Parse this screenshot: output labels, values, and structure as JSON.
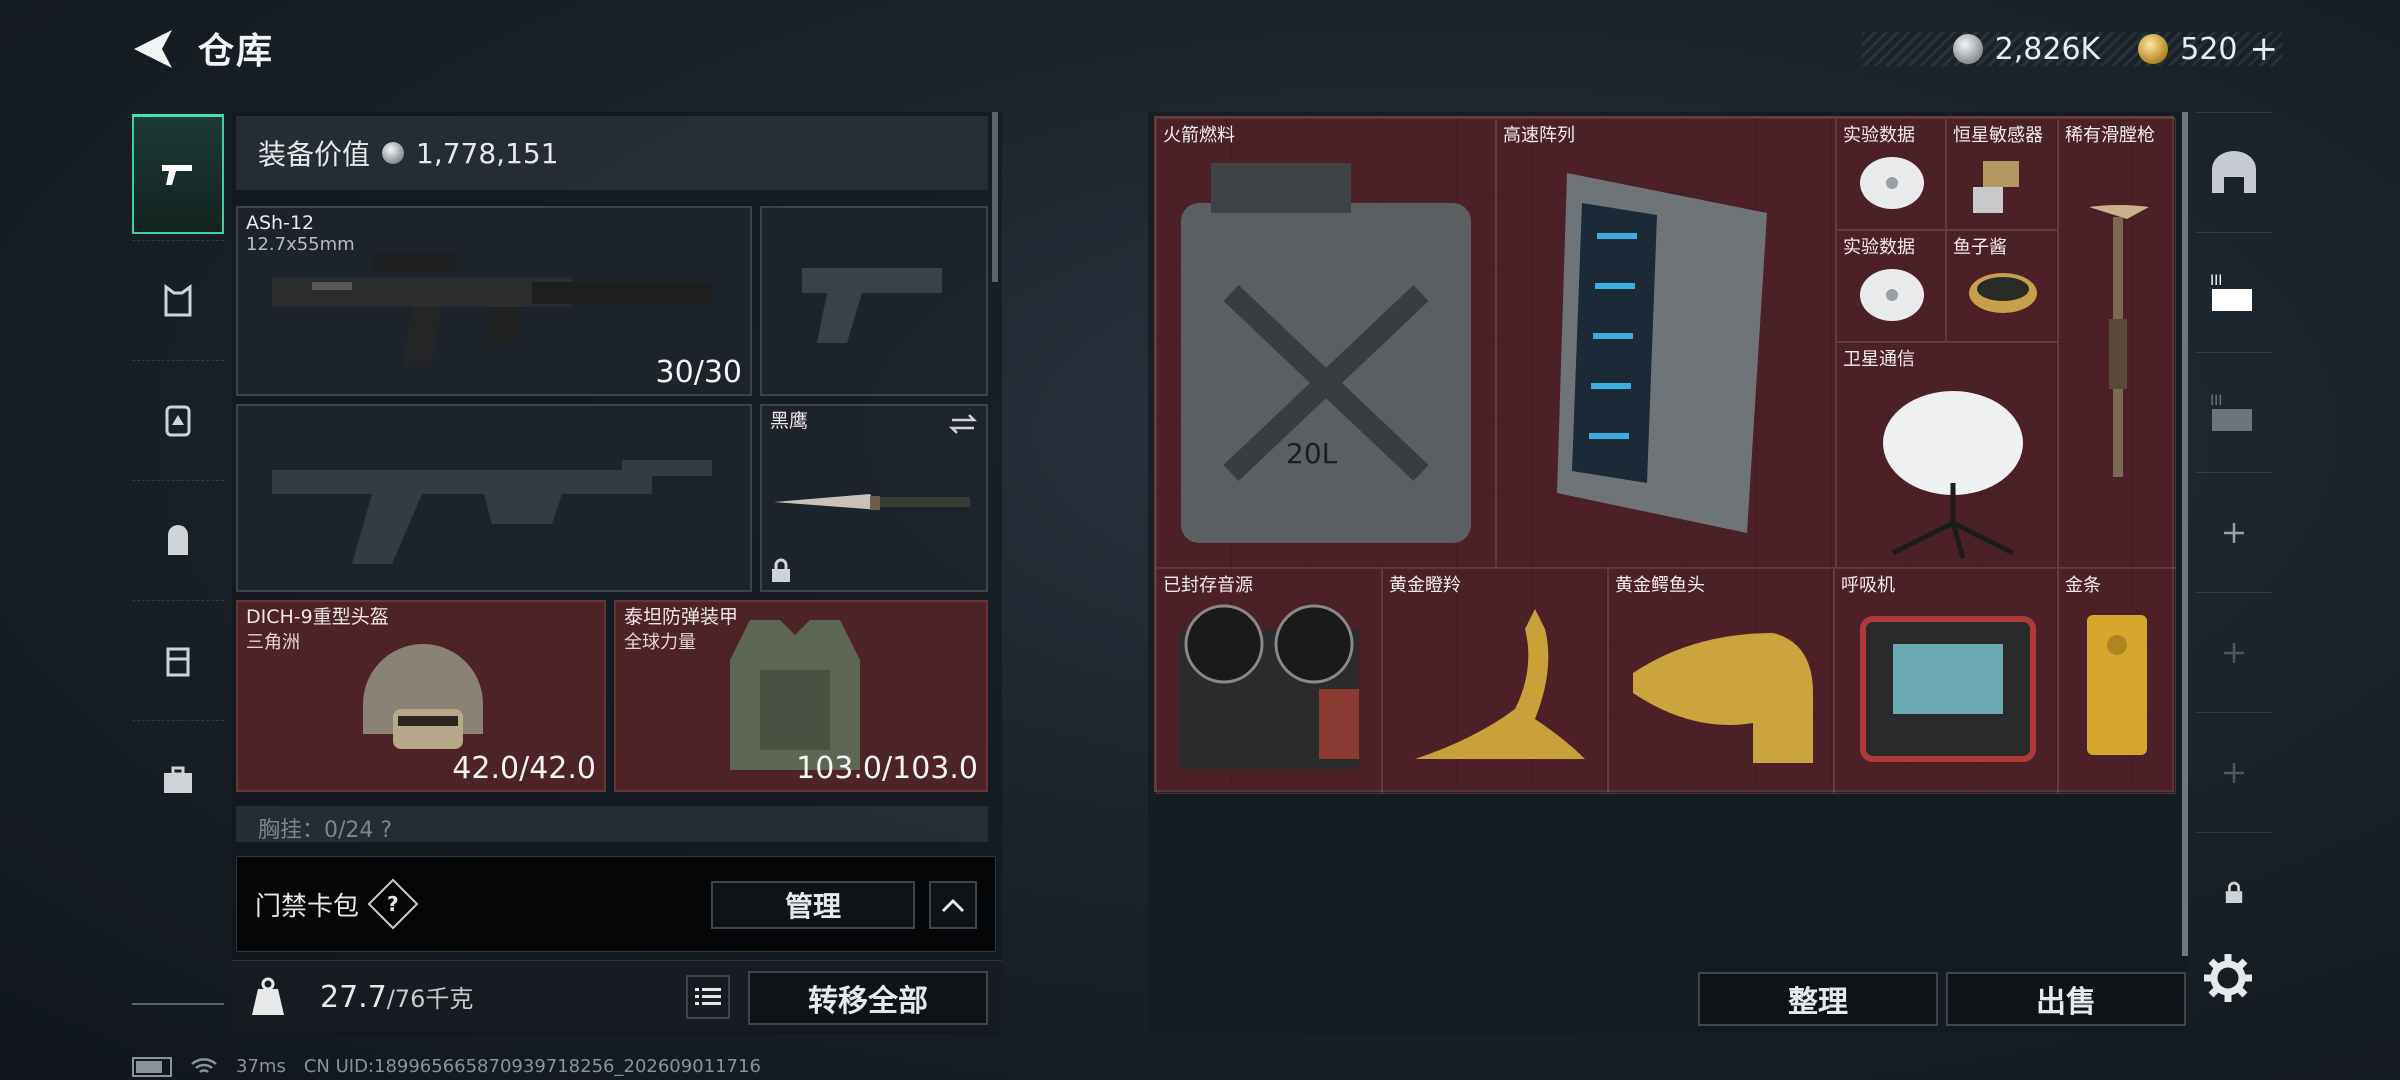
{
  "header": {
    "title": "仓库",
    "currency_silver": "2,826K",
    "currency_gold": "520",
    "currency_add": "+"
  },
  "loadout": {
    "value_label": "装备价值",
    "value": "1,778,151",
    "primary_weapon": {
      "name": "ASh-12",
      "caliber": "12.7x55mm",
      "ammo": "30/30"
    },
    "melee": {
      "name": "黑鹰"
    },
    "helmet": {
      "name": "DICH-9重型头盔",
      "brand": "三角洲",
      "durability": "42.0/42.0"
    },
    "armor": {
      "name": "泰坦防弹装甲",
      "brand": "全球力量",
      "durability": "103.0/103.0"
    },
    "chest_rig_peek": "胸挂：0/24  ?"
  },
  "keybag": {
    "label": "门禁卡包",
    "help": "?",
    "manage_label": "管理"
  },
  "weight": {
    "current": "27.7",
    "max": "/76千克",
    "transfer_all_label": "转移全部"
  },
  "stash": {
    "items": [
      {
        "name": "火箭燃料"
      },
      {
        "name": "高速阵列"
      },
      {
        "name": "实验数据"
      },
      {
        "name": "恒星敏感器"
      },
      {
        "name": "稀有滑膛枪"
      },
      {
        "name": "实验数据"
      },
      {
        "name": "鱼子酱"
      },
      {
        "name": "卫星通信"
      },
      {
        "name": "已封存音源"
      },
      {
        "name": "黄金瞪羚"
      },
      {
        "name": "黄金鳄鱼头"
      },
      {
        "name": "呼吸机"
      },
      {
        "name": "金条"
      }
    ],
    "jerrycan_text": "20L",
    "tidy_label": "整理",
    "sell_label": "出售"
  },
  "status": {
    "ping": "37ms",
    "uid": "CN UID:1899656658709397182​56_202609011716"
  },
  "colors": {
    "accent": "#3ad0a0",
    "slot_red": "#4e2328",
    "stash_bg": "#4a2127"
  }
}
